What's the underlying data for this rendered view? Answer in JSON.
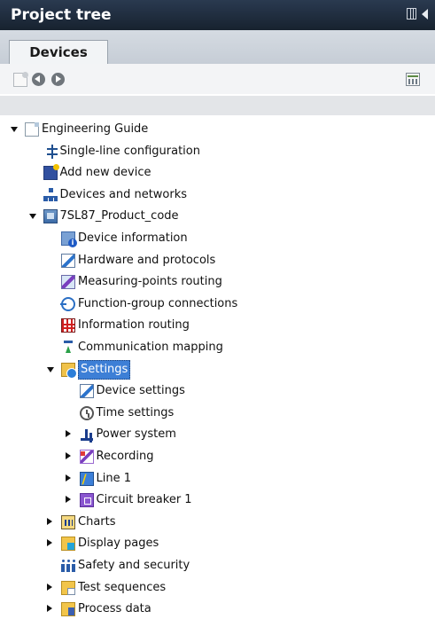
{
  "panel": {
    "title": "Project tree",
    "tab_label": "Devices"
  },
  "toolbar": {
    "buttons": [
      "add-new-icon",
      "back-icon",
      "forward-icon",
      "configure-icon"
    ]
  },
  "tree": [
    {
      "label": "Engineering Guide",
      "expander": "open",
      "icon": "document-icon",
      "selected": false
    },
    {
      "label": "Single-line configuration",
      "expander": "none",
      "icon": "single-line-icon",
      "selected": false
    },
    {
      "label": "Add new device",
      "expander": "none",
      "icon": "add-device-icon",
      "selected": false
    },
    {
      "label": "Devices and networks",
      "expander": "none",
      "icon": "network-icon",
      "selected": false
    },
    {
      "label": "7SL87_Product_code",
      "expander": "open",
      "icon": "device-icon",
      "selected": false
    },
    {
      "label": "Device information",
      "expander": "none",
      "icon": "device-info-icon",
      "selected": false
    },
    {
      "label": "Hardware and protocols",
      "expander": "none",
      "icon": "hardware-icon",
      "selected": false
    },
    {
      "label": "Measuring-points routing",
      "expander": "none",
      "icon": "measuring-icon",
      "selected": false
    },
    {
      "label": "Function-group connections",
      "expander": "none",
      "icon": "function-group-icon",
      "selected": false
    },
    {
      "label": "Information routing",
      "expander": "none",
      "icon": "information-routing-icon",
      "selected": false
    },
    {
      "label": "Communication mapping",
      "expander": "none",
      "icon": "communication-mapping-icon",
      "selected": false
    },
    {
      "label": "Settings",
      "expander": "open",
      "icon": "settings-folder-icon",
      "selected": true
    },
    {
      "label": "Device settings",
      "expander": "none",
      "icon": "device-settings-icon",
      "selected": false
    },
    {
      "label": "Time settings",
      "expander": "none",
      "icon": "time-settings-icon",
      "selected": false
    },
    {
      "label": "Power system",
      "expander": "closed",
      "icon": "power-system-icon",
      "selected": false
    },
    {
      "label": "Recording",
      "expander": "closed",
      "icon": "recording-icon",
      "selected": false
    },
    {
      "label": "Line 1",
      "expander": "closed",
      "icon": "line-icon",
      "selected": false
    },
    {
      "label": "Circuit breaker 1",
      "expander": "closed",
      "icon": "circuit-breaker-icon",
      "selected": false
    },
    {
      "label": "Charts",
      "expander": "closed",
      "icon": "charts-icon",
      "selected": false
    },
    {
      "label": "Display pages",
      "expander": "closed",
      "icon": "display-pages-icon",
      "selected": false
    },
    {
      "label": "Safety and security",
      "expander": "none",
      "icon": "safety-security-icon",
      "selected": false
    },
    {
      "label": "Test sequences",
      "expander": "closed",
      "icon": "test-sequences-icon",
      "selected": false
    },
    {
      "label": "Process data",
      "expander": "closed",
      "icon": "process-data-icon",
      "selected": false
    }
  ]
}
